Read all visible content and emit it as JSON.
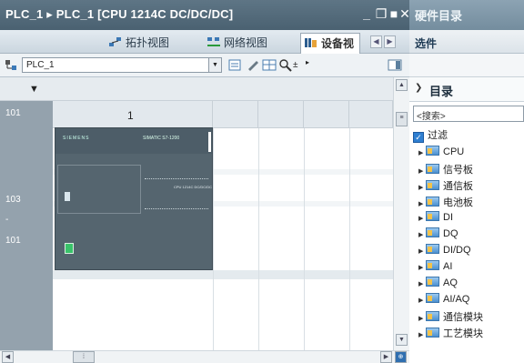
{
  "window": {
    "title": "PLC_1 ▸ PLC_1 [CPU 1214C DC/DC/DC]"
  },
  "view_tabs": {
    "topology": "拓扑视图",
    "network": "网络视图",
    "device": "设备视"
  },
  "toolbar": {
    "device_selector": "PLC_1"
  },
  "rack": {
    "slot_header": "1",
    "row_labels": [
      "101",
      "103",
      "-",
      "101"
    ],
    "module": {
      "brand": "SIEMENS",
      "model": "SIMATIC S7-1200",
      "label": "CPU 1214C DC/DC/DC"
    }
  },
  "catalog_panel": {
    "title": "硬件目录",
    "options": "选件",
    "catalog_header": "目录",
    "search_placeholder": "<搜索>",
    "filter_label": "过滤",
    "items": [
      "CPU",
      "信号板",
      "通信板",
      "电池板",
      "DI",
      "DQ",
      "DI/DQ",
      "AI",
      "AQ",
      "AI/AQ",
      "通信模块",
      "工艺模块"
    ]
  },
  "colors": {
    "title_bar": "#4a6171",
    "rack_rownum": "#94a2ad",
    "plc_body": "#55656f",
    "port_green": "#39c36a",
    "filter_check": "#2f7fd1"
  }
}
